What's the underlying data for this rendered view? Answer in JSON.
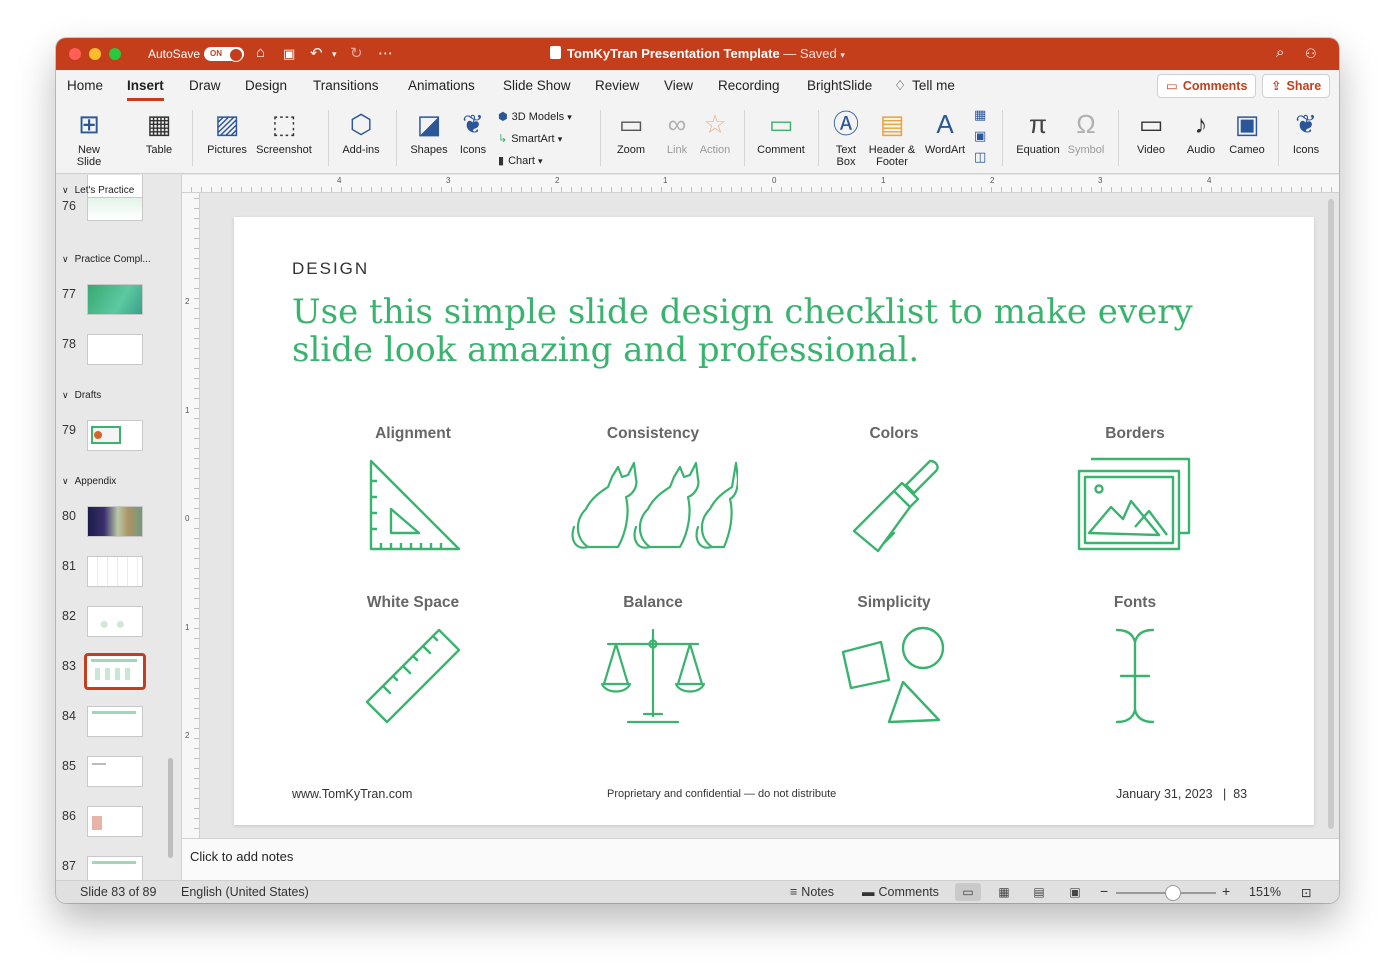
{
  "app": {
    "autosave_label": "AutoSave",
    "autosave_state": "ON",
    "doc_title": "TomKyTran Presentation Template",
    "doc_status": "— Saved",
    "brand_color": "#c43e1c",
    "accent_green": "#3ab36f"
  },
  "menu": {
    "tabs": [
      "Home",
      "Insert",
      "Draw",
      "Design",
      "Transitions",
      "Animations",
      "Slide Show",
      "Review",
      "View",
      "Recording",
      "BrightSlide"
    ],
    "active_tab": "Insert",
    "tell_me": "Tell me",
    "comments_button": "Comments",
    "share_button": "Share"
  },
  "ribbon": {
    "new_slide": "New\nSlide",
    "table": "Table",
    "pictures": "Pictures",
    "screenshot": "Screenshot",
    "addins": "Add-ins",
    "shapes": "Shapes",
    "icons": "Icons",
    "models3d": "3D Models",
    "smartart": "SmartArt",
    "chart": "Chart",
    "zoom": "Zoom",
    "link": "Link",
    "action": "Action",
    "comment": "Comment",
    "textbox": "Text\nBox",
    "header_footer": "Header &\nFooter",
    "wordart": "WordArt",
    "equation": "Equation",
    "symbol": "Symbol",
    "video": "Video",
    "audio": "Audio",
    "cameo": "Cameo",
    "icons2": "Icons"
  },
  "ruler": {
    "h_numbers": [
      "4",
      "3",
      "2",
      "1",
      "0",
      "1",
      "2",
      "3",
      "4"
    ],
    "v_numbers": [
      "2",
      "1",
      "0",
      "1",
      "2"
    ]
  },
  "thumbnails": {
    "sections": [
      {
        "label": "Let's Practice"
      },
      {
        "label": "Practice Compl..."
      },
      {
        "label": "Drafts"
      },
      {
        "label": "Appendix"
      }
    ],
    "slides": [
      {
        "num": "76"
      },
      {
        "num": "77"
      },
      {
        "num": "78"
      },
      {
        "num": "79"
      },
      {
        "num": "80"
      },
      {
        "num": "81"
      },
      {
        "num": "82"
      },
      {
        "num": "83",
        "selected": true
      },
      {
        "num": "84"
      },
      {
        "num": "85"
      },
      {
        "num": "86"
      },
      {
        "num": "87"
      }
    ]
  },
  "slide": {
    "kicker": "DESIGN",
    "title": "Use this simple slide design checklist to make every slide look amazing and professional.",
    "items": [
      {
        "label": "Alignment",
        "icon": "set-square-icon"
      },
      {
        "label": "Consistency",
        "icon": "three-cats-icon"
      },
      {
        "label": "Colors",
        "icon": "paintbrush-icon"
      },
      {
        "label": "Borders",
        "icon": "framed-picture-icon"
      },
      {
        "label": "White Space",
        "icon": "ruler-icon"
      },
      {
        "label": "Balance",
        "icon": "balance-scale-icon"
      },
      {
        "label": "Simplicity",
        "icon": "shapes-icon"
      },
      {
        "label": "Fonts",
        "icon": "text-cursor-icon"
      }
    ],
    "footer_left": "www.TomKyTran.com",
    "footer_center": "Proprietary and confidential — do not distribute",
    "footer_right": "January 31, 2023   |  83"
  },
  "notes": {
    "placeholder": "Click to add notes"
  },
  "status": {
    "slide_counter": "Slide 83 of 89",
    "language": "English (United States)",
    "notes_button": "Notes",
    "comments_button": "Comments",
    "zoom_level": "151%"
  }
}
